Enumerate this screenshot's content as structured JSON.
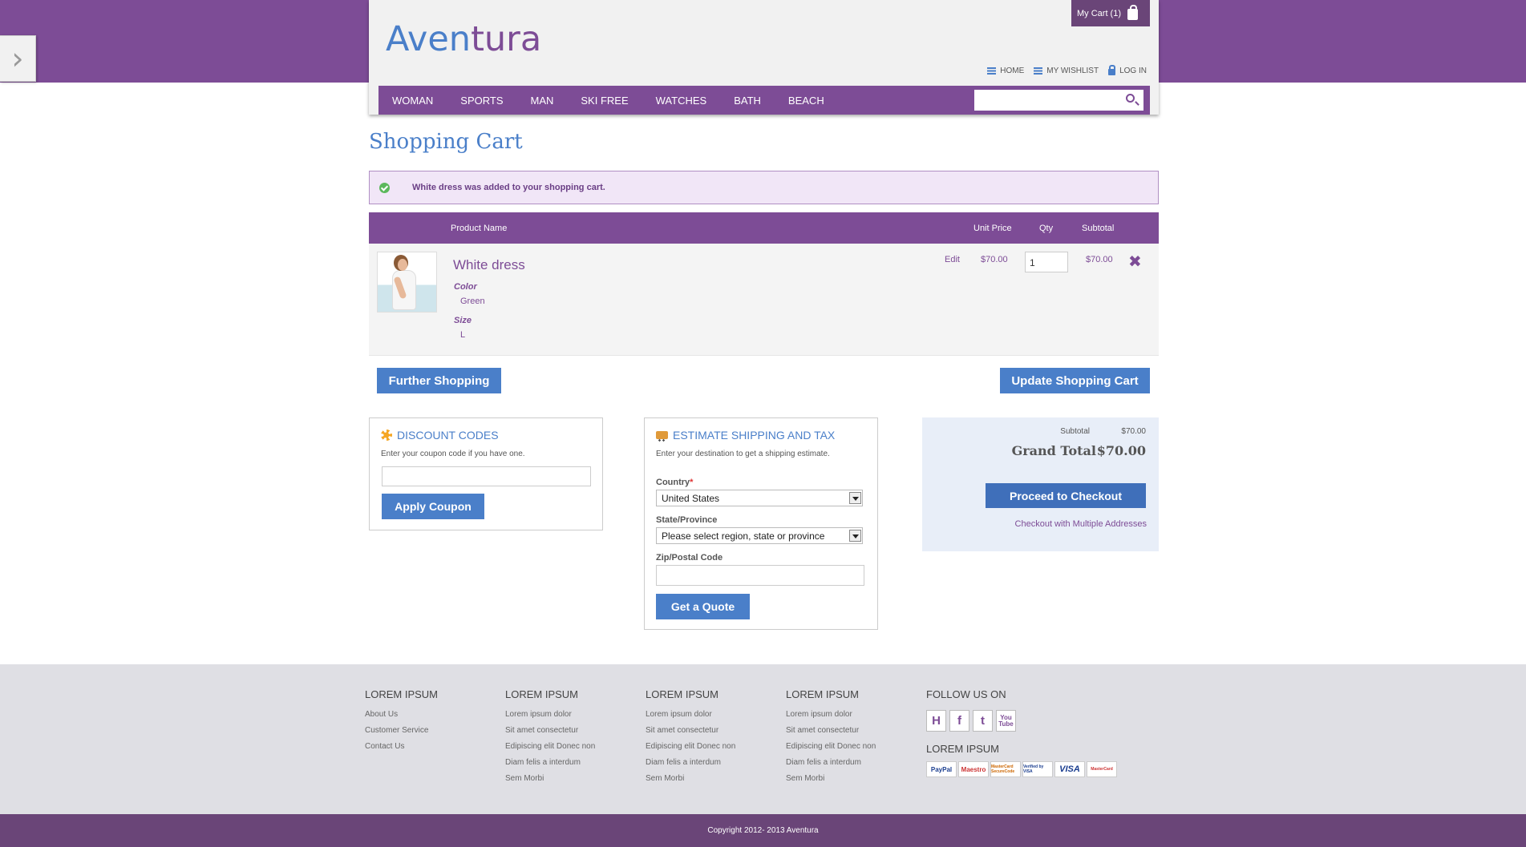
{
  "header": {
    "logo_part1": "Aven",
    "logo_part2": "tura",
    "cart_label": "My Cart (1)",
    "links": {
      "home": "HOME",
      "wishlist": "MY WISHLIST",
      "login": "LOG IN"
    },
    "nav": [
      "WOMAN",
      "SPORTS",
      "MAN",
      "SKI FREE",
      "WATCHES",
      "BATH",
      "BEACH"
    ],
    "search_placeholder": ""
  },
  "page": {
    "title": "Shopping Cart",
    "message": "White dress was added to your shopping cart."
  },
  "table": {
    "headers": {
      "product": "Product Name",
      "unit_price": "Unit Price",
      "qty": "Qty",
      "subtotal": "Subtotal"
    },
    "rows": [
      {
        "name": "White dress",
        "options": [
          {
            "label": "Color",
            "value": "Green"
          },
          {
            "label": "Size",
            "value": "L"
          }
        ],
        "edit": "Edit",
        "unit_price": "$70.00",
        "qty": "1",
        "subtotal": "$70.00",
        "remove_icon": "close-icon"
      }
    ]
  },
  "actions": {
    "further_shopping": "Further Shopping",
    "update_cart": "Update Shopping Cart"
  },
  "discount": {
    "title": "DISCOUNT CODES",
    "subtitle": "Enter your coupon code if you have one.",
    "input_value": "",
    "button": "Apply Coupon"
  },
  "shipping": {
    "title": "ESTIMATE SHIPPING AND TAX",
    "subtitle": "Enter your destination to get a shipping estimate.",
    "country_label": "Country",
    "country_required": "*",
    "country_value": "United States",
    "state_label": "State/Province",
    "state_value": "Please select region, state or province",
    "zip_label": "Zip/Postal Code",
    "zip_value": "",
    "button": "Get a Quote"
  },
  "totals": {
    "subtotal_label": "Subtotal",
    "subtotal_value": "$70.00",
    "grand_label": "Grand Total",
    "grand_value": "$70.00",
    "checkout_button": "Proceed to Checkout",
    "multi_link": "Checkout with Multiple Addresses"
  },
  "footer": {
    "columns": [
      {
        "heading": "LOREM IPSUM",
        "links": [
          "About Us",
          "Customer Service",
          "Contact Us"
        ]
      },
      {
        "heading": "LOREM IPSUM",
        "links": [
          "Lorem ipsum dolor",
          "Sit amet consectetur",
          "Edipiscing elit Donec non",
          "Diam felis a interdum",
          "Sem Morbi"
        ]
      },
      {
        "heading": "LOREM IPSUM",
        "links": [
          "Lorem ipsum dolor",
          "Sit amet consectetur",
          "Edipiscing elit Donec non",
          "Diam felis a interdum",
          "Sem Morbi"
        ]
      },
      {
        "heading": "LOREM IPSUM",
        "links": [
          "Lorem ipsum dolor",
          "Sit amet consectetur",
          "Edipiscing elit Donec non",
          "Diam felis a interdum",
          "Sem Morbi"
        ]
      }
    ],
    "follow_heading": "FOLLOW US ON",
    "social": [
      {
        "name": "hyves-icon",
        "glyph": "H"
      },
      {
        "name": "facebook-icon",
        "glyph": "f"
      },
      {
        "name": "twitter-icon",
        "glyph": "t"
      },
      {
        "name": "youtube-icon",
        "glyph": "You Tube"
      }
    ],
    "payment_heading": "LOREM IPSUM",
    "payments": [
      "PayPal",
      "Maestro",
      "MasterCard SecureCode",
      "Verified by VISA",
      "VISA",
      "MasterCard"
    ],
    "copyright": "Copyright 2012- 2013 Aventura"
  },
  "colors": {
    "brand_purple": "#7d4c96",
    "accent_blue": "#4a7fc9",
    "dark_purple": "#6a4578"
  }
}
